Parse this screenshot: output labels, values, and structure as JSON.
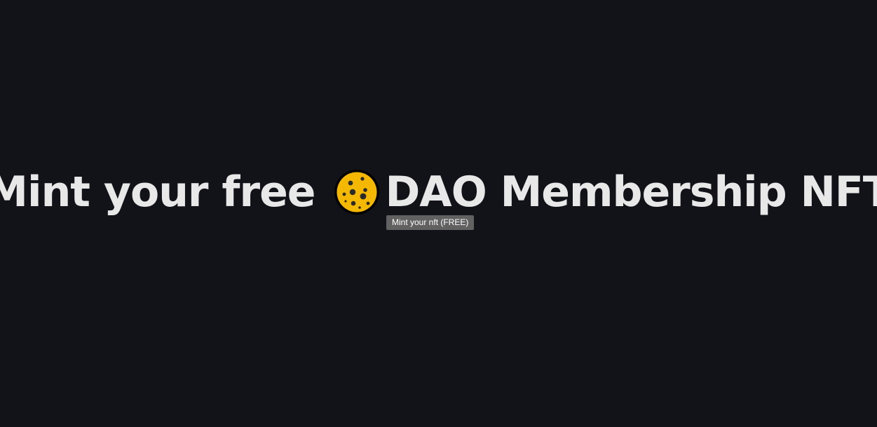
{
  "page": {
    "background_color": "#111318"
  },
  "headline": {
    "text_before": "Mint your free",
    "icon": "cookie-icon",
    "icon_color": "#f5b800",
    "text_after": "DAO Membership NFT",
    "color": "#e8e8e8"
  },
  "tooltip": {
    "text": "Mint your nft (FREE)",
    "background_color": "#616161"
  }
}
